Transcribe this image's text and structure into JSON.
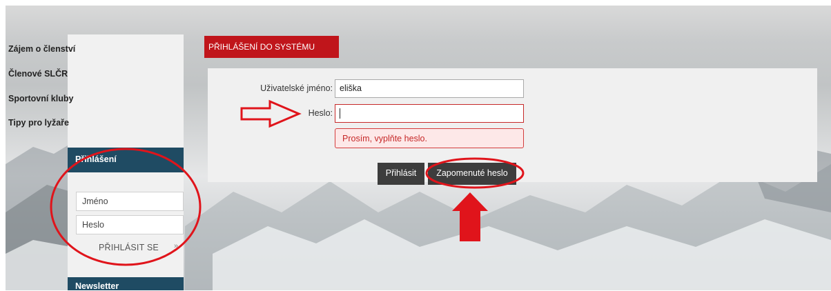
{
  "sidebar": {
    "nav_items": [
      {
        "label": "Zájem o členství"
      },
      {
        "label": "Členové SLČR"
      },
      {
        "label": "Sportovní kluby"
      },
      {
        "label": "Tipy pro lyžaře"
      }
    ],
    "login_panel": {
      "title": "Přihlášení",
      "name_placeholder": "Jméno",
      "password_placeholder": "Heslo",
      "submit_label": "PŘIHLÁSIT SE",
      "arrow_glyph": "»"
    },
    "newsletter_title": "Newsletter"
  },
  "main": {
    "tab_title": "PŘIHLÁŠENÍ DO SYSTÉMU",
    "form": {
      "username_label": "Uživatelské jméno:",
      "username_value": "eliška",
      "password_label": "Heslo:",
      "password_value": "",
      "error_message": "Prosím, vyplňte heslo.",
      "login_button": "Přihlásit",
      "forgot_button": "Zapomenuté heslo"
    }
  },
  "colors": {
    "brand_red": "#c0151b",
    "panel_blue": "#1f4b63",
    "annotation_red": "#e0141b",
    "button_dark": "#3d3d3d"
  }
}
